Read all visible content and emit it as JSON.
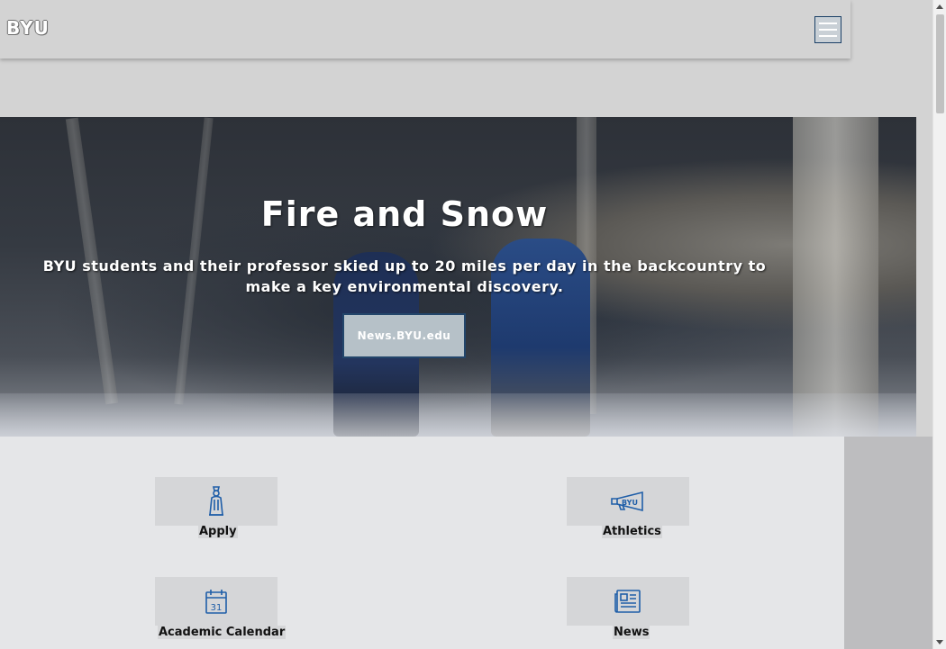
{
  "header": {
    "logo_text": "BYU",
    "menu_icon": "hamburger-menu-icon"
  },
  "hero": {
    "title": "Fire and Snow",
    "subtitle": "BYU students and their professor skied up to 20 miles per day in the backcountry to make a key environmental discovery.",
    "button_label": "News.BYU.edu"
  },
  "quick_links": [
    {
      "label": "Apply",
      "icon": "graduate-figure-icon"
    },
    {
      "label": "Athletics",
      "icon": "megaphone-icon"
    },
    {
      "label": "Academic Calendar",
      "icon": "calendar-icon",
      "icon_text": "31"
    },
    {
      "label": "News",
      "icon": "newspaper-icon"
    }
  ],
  "colors": {
    "page_bg": "#d3d3d3",
    "icon_blue": "#1f5ea8",
    "button_border": "#23466b",
    "links_bg": "#e5e6e8"
  }
}
